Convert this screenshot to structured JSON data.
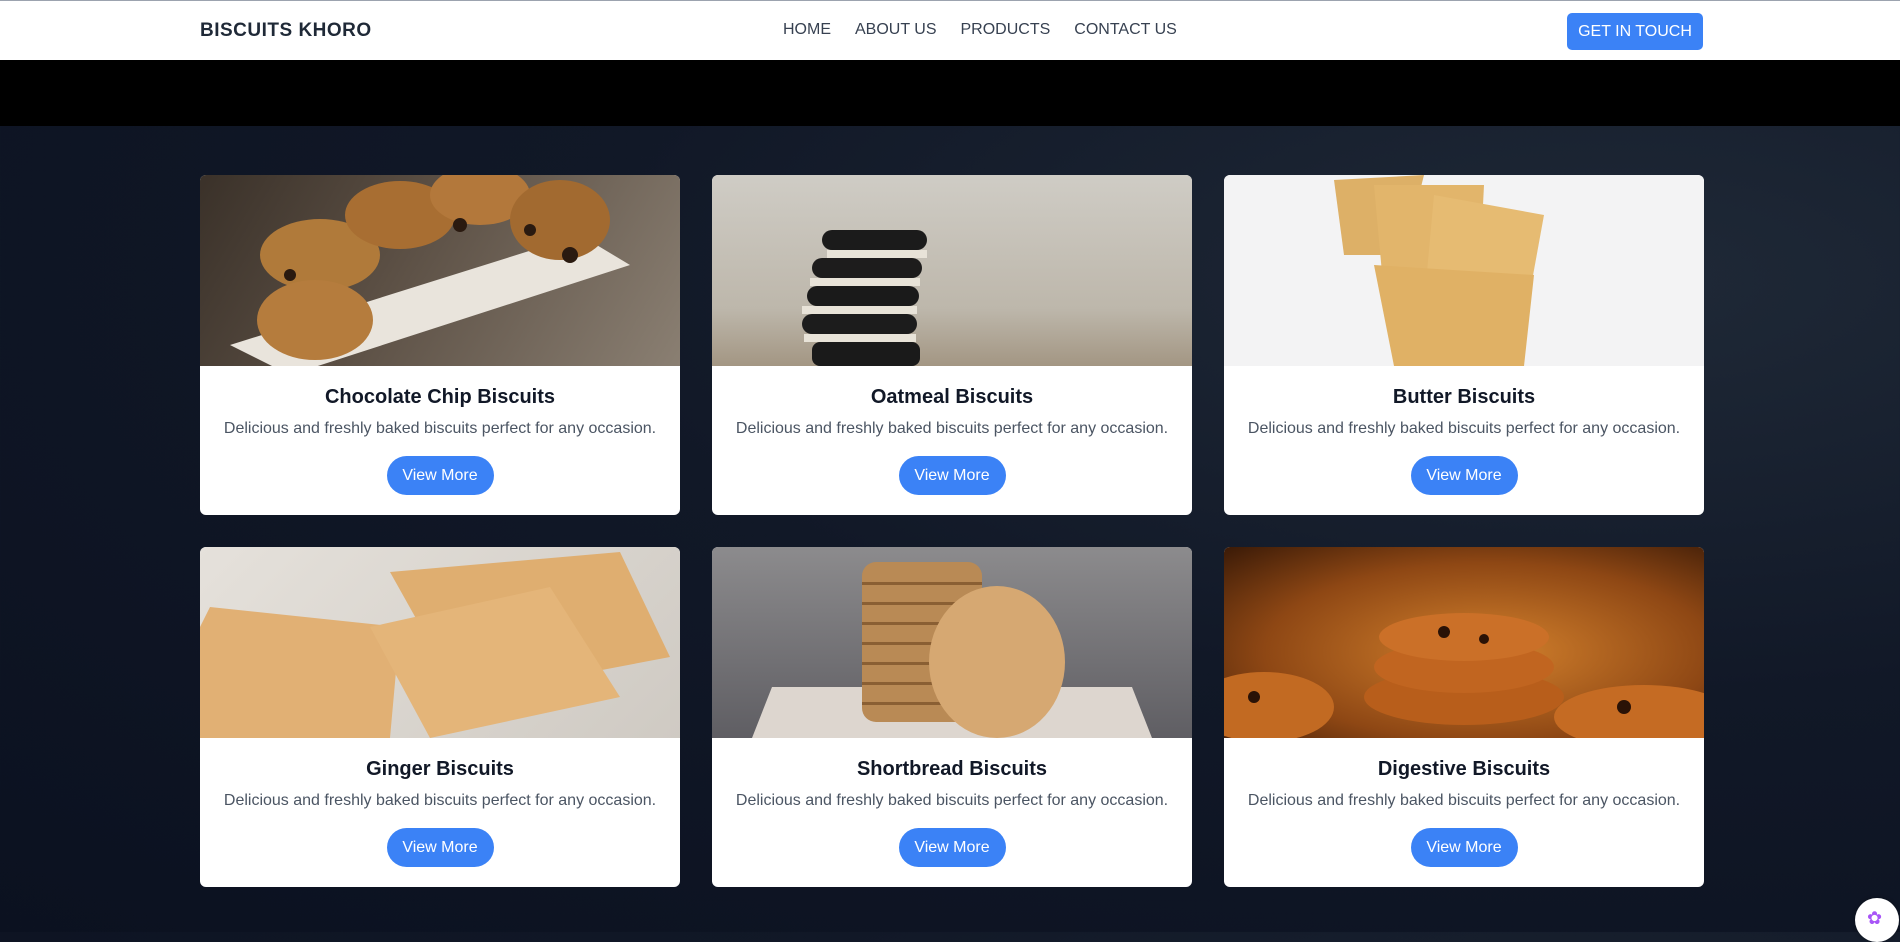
{
  "navbar": {
    "brand": "BISCUITS KHORO",
    "links": [
      "HOME",
      "ABOUT US",
      "PRODUCTS",
      "CONTACT US"
    ],
    "cta": "GET IN TOUCH"
  },
  "products": [
    {
      "title": "Chocolate Chip Biscuits",
      "description": "Delicious and freshly baked biscuits perfect for any occasion.",
      "button": "View More"
    },
    {
      "title": "Oatmeal Biscuits",
      "description": "Delicious and freshly baked biscuits perfect for any occasion.",
      "button": "View More"
    },
    {
      "title": "Butter Biscuits",
      "description": "Delicious and freshly baked biscuits perfect for any occasion.",
      "button": "View More"
    },
    {
      "title": "Ginger Biscuits",
      "description": "Delicious and freshly baked biscuits perfect for any occasion.",
      "button": "View More"
    },
    {
      "title": "Shortbread Biscuits",
      "description": "Delicious and freshly baked biscuits perfect for any occasion.",
      "button": "View More"
    },
    {
      "title": "Digestive Biscuits",
      "description": "Delicious and freshly baked biscuits perfect for any occasion.",
      "button": "View More"
    }
  ],
  "colors": {
    "accent": "#3b82f6",
    "background_dark": "#111827",
    "card": "#ffffff"
  },
  "icons": {
    "assistant": "brain-icon"
  }
}
